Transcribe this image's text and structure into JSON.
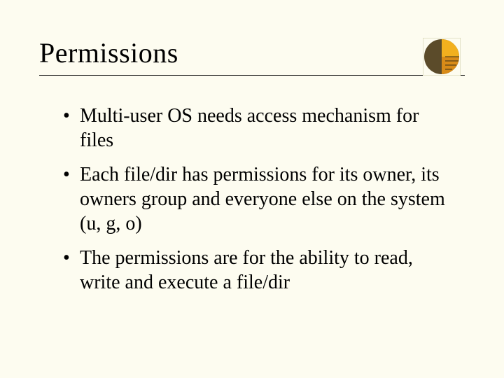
{
  "title": "Permissions",
  "bullets": [
    "Multi-user OS needs access mechanism for files",
    "Each file/dir has permissions for its owner, its owners group and everyone else on the system (u, g, o)",
    "The permissions are for the ability to read, write and execute a file/dir"
  ]
}
